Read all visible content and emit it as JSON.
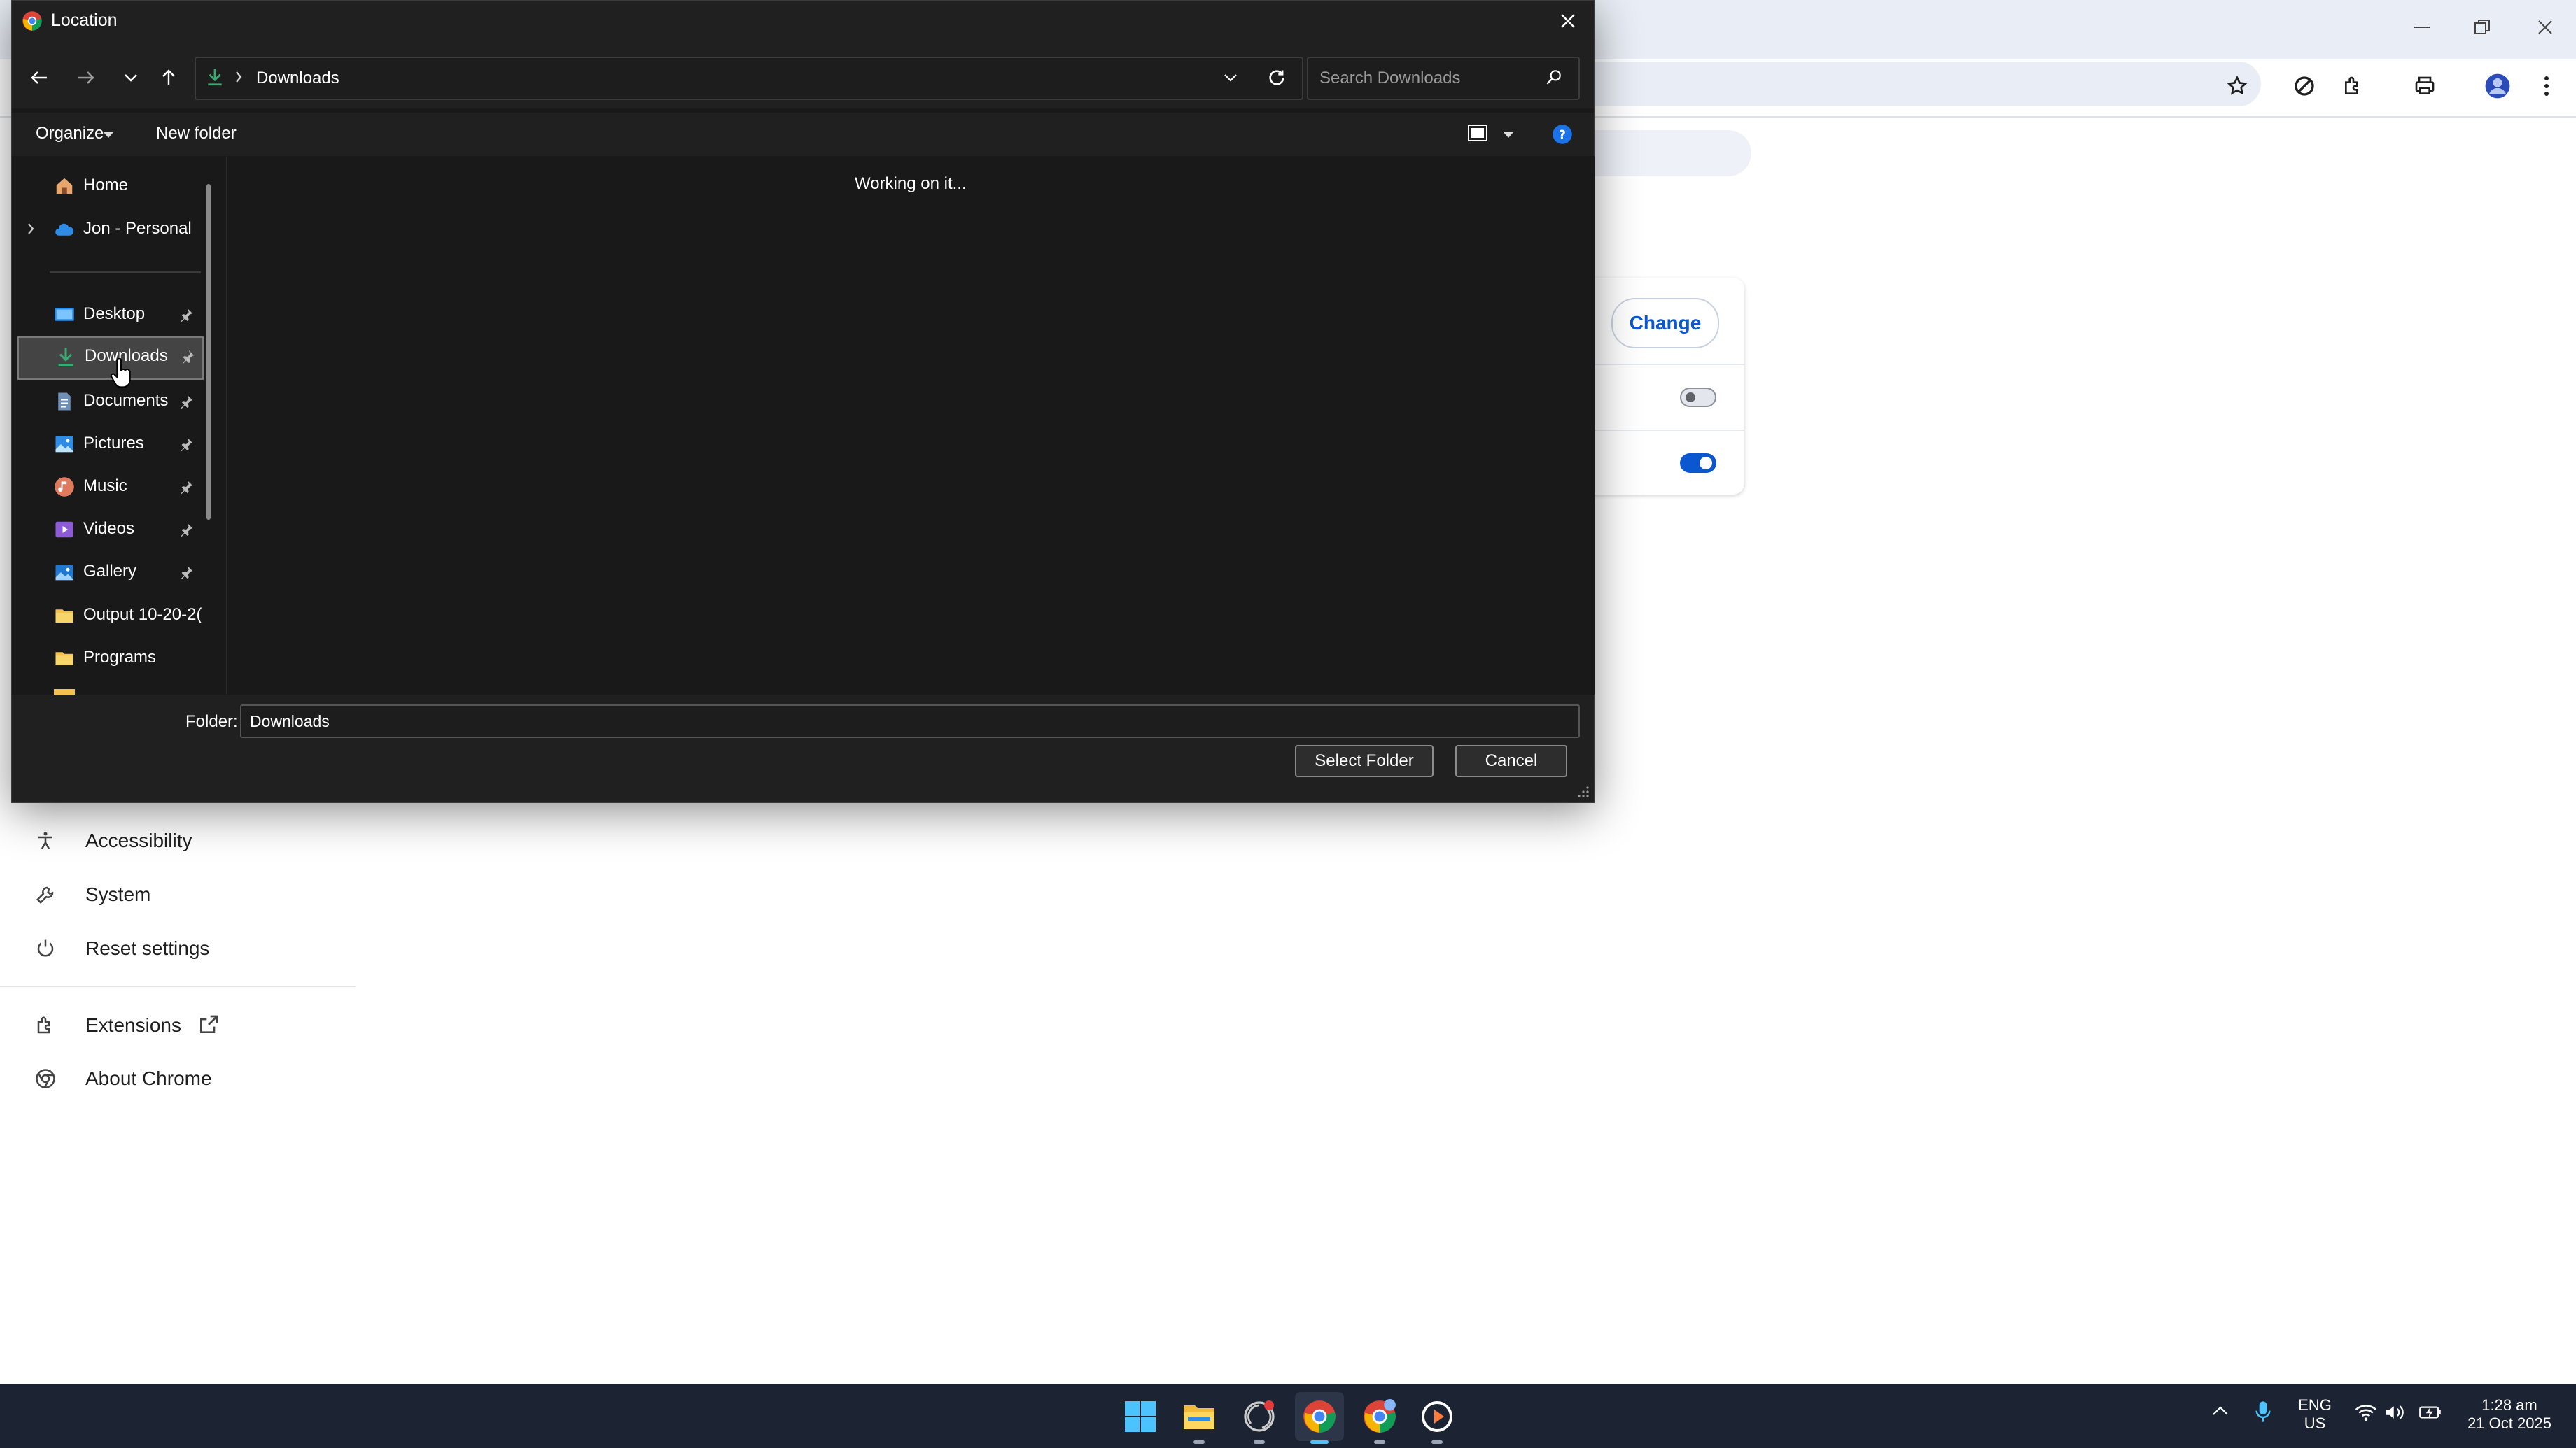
{
  "dialog": {
    "title": "Location",
    "address": "Downloads",
    "search_placeholder": "Search Downloads",
    "commands": {
      "organize": "Organize",
      "new_folder": "New folder"
    },
    "nav_items": [
      {
        "label": "Home",
        "icon": "home-icon"
      },
      {
        "label": "Jon - Personal",
        "icon": "cloud-icon"
      },
      {
        "label": "Desktop",
        "icon": "desktop-icon"
      },
      {
        "label": "Downloads",
        "icon": "download-icon",
        "selected": true
      },
      {
        "label": "Documents",
        "icon": "document-icon"
      },
      {
        "label": "Pictures",
        "icon": "pictures-icon"
      },
      {
        "label": "Music",
        "icon": "music-icon"
      },
      {
        "label": "Videos",
        "icon": "videos-icon"
      },
      {
        "label": "Gallery",
        "icon": "gallery-icon"
      },
      {
        "label": "Output 10-20-2(",
        "icon": "folder-icon"
      },
      {
        "label": "Programs",
        "icon": "folder-icon"
      }
    ],
    "status": "Working on it...",
    "folder_label": "Folder:",
    "folder_value": "Downloads",
    "select_button": "Select Folder",
    "cancel_button": "Cancel"
  },
  "settings": {
    "change_button": "Change",
    "nav": [
      {
        "label": "Accessibility",
        "icon": "accessibility-icon"
      },
      {
        "label": "System",
        "icon": "wrench-icon"
      },
      {
        "label": "Reset settings",
        "icon": "reset-icon"
      },
      {
        "label": "Extensions",
        "icon": "extensions-icon"
      },
      {
        "label": "About Chrome",
        "icon": "chrome-icon"
      }
    ]
  },
  "taskbar": {
    "language": "ENG",
    "region": "US",
    "time": "1:28 am",
    "date": "21 Oct 2025"
  },
  "colors": {
    "accent_blue": "#0b57d0",
    "dialog_bg": "#191919",
    "taskbar_bg": "#1c2433"
  }
}
